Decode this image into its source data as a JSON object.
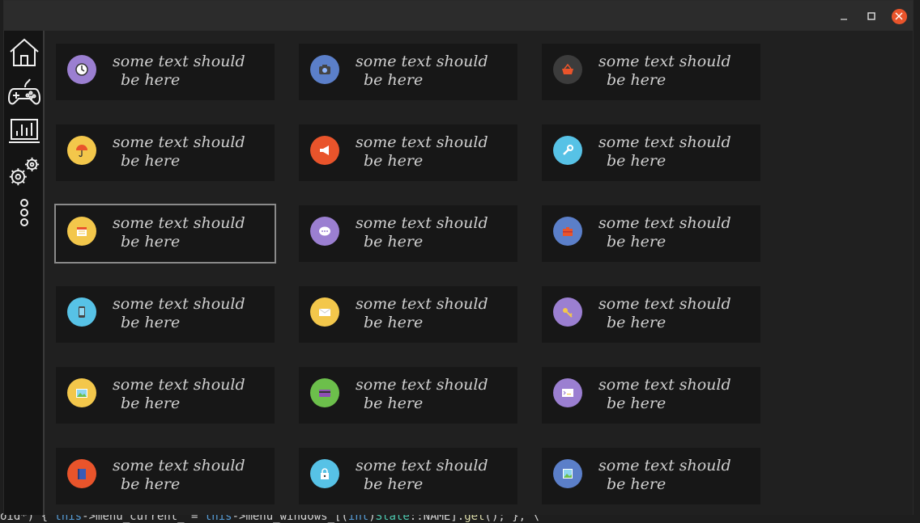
{
  "window": {
    "controls": {
      "minimize": "minimize-icon",
      "maximize": "maximize-icon",
      "close": "close-icon"
    },
    "accent": "#e9542b"
  },
  "sidebar": {
    "items": [
      {
        "icon": "home-icon"
      },
      {
        "icon": "gamepad-icon"
      },
      {
        "icon": "chart-icon"
      },
      {
        "icon": "gears-icon"
      },
      {
        "icon": "more-icon"
      }
    ]
  },
  "cards": [
    {
      "icon": "clock-icon",
      "color": "#9b7fd1",
      "line1": "some text should",
      "line2": "be here"
    },
    {
      "icon": "camera-icon",
      "color": "#5b7fc9",
      "line1": "some text should",
      "line2": "be here"
    },
    {
      "icon": "basket-icon",
      "color": "#3c3c3c",
      "line1": "some text should",
      "line2": "be here"
    },
    {
      "icon": "umbrella-icon",
      "color": "#f3c74b",
      "line1": "some text should",
      "line2": "be here"
    },
    {
      "icon": "megaphone-icon",
      "color": "#e9542b",
      "line1": "some text should",
      "line2": "be here"
    },
    {
      "icon": "wrench-icon",
      "color": "#57c2e6",
      "line1": "some text should",
      "line2": "be here"
    },
    {
      "icon": "calendar-icon",
      "color": "#f3c74b",
      "line1": "some text should",
      "line2": "be here"
    },
    {
      "icon": "chat-icon",
      "color": "#9b7fd1",
      "line1": "some text should",
      "line2": "be here"
    },
    {
      "icon": "toolbox-icon",
      "color": "#5b7fc9",
      "line1": "some text should",
      "line2": "be here"
    },
    {
      "icon": "phone-icon",
      "color": "#57c2e6",
      "line1": "some text should",
      "line2": "be here"
    },
    {
      "icon": "mail-icon",
      "color": "#f3c74b",
      "line1": "some text should",
      "line2": "be here"
    },
    {
      "icon": "key-icon",
      "color": "#9b7fd1",
      "line1": "some text should",
      "line2": "be here"
    },
    {
      "icon": "image-icon",
      "color": "#f3c74b",
      "line1": "some text should",
      "line2": "be here"
    },
    {
      "icon": "credit-card-icon",
      "color": "#6cbf4b",
      "line1": "some text should",
      "line2": "be here"
    },
    {
      "icon": "terminal-icon",
      "color": "#9b7fd1",
      "line1": "some text should",
      "line2": "be here"
    },
    {
      "icon": "book-icon",
      "color": "#e9542b",
      "line1": "some text should",
      "line2": "be here"
    },
    {
      "icon": "lock-icon",
      "color": "#57c2e6",
      "line1": "some text should",
      "line2": "be here"
    },
    {
      "icon": "picture-icon",
      "color": "#5b7fc9",
      "line1": "some text should",
      "line2": "be here"
    }
  ],
  "selected_card": 6,
  "background_code": {
    "p1": "oid*) { ",
    "p2": "this",
    "p3": "->menu_current_ = ",
    "p4": "this",
    "p5": "->menu_windows_[(",
    "p6": "int",
    "p7": ")",
    "p8": "State",
    "p9": "::NAME].",
    "p10": "get",
    "p11": "(); }, \\"
  }
}
